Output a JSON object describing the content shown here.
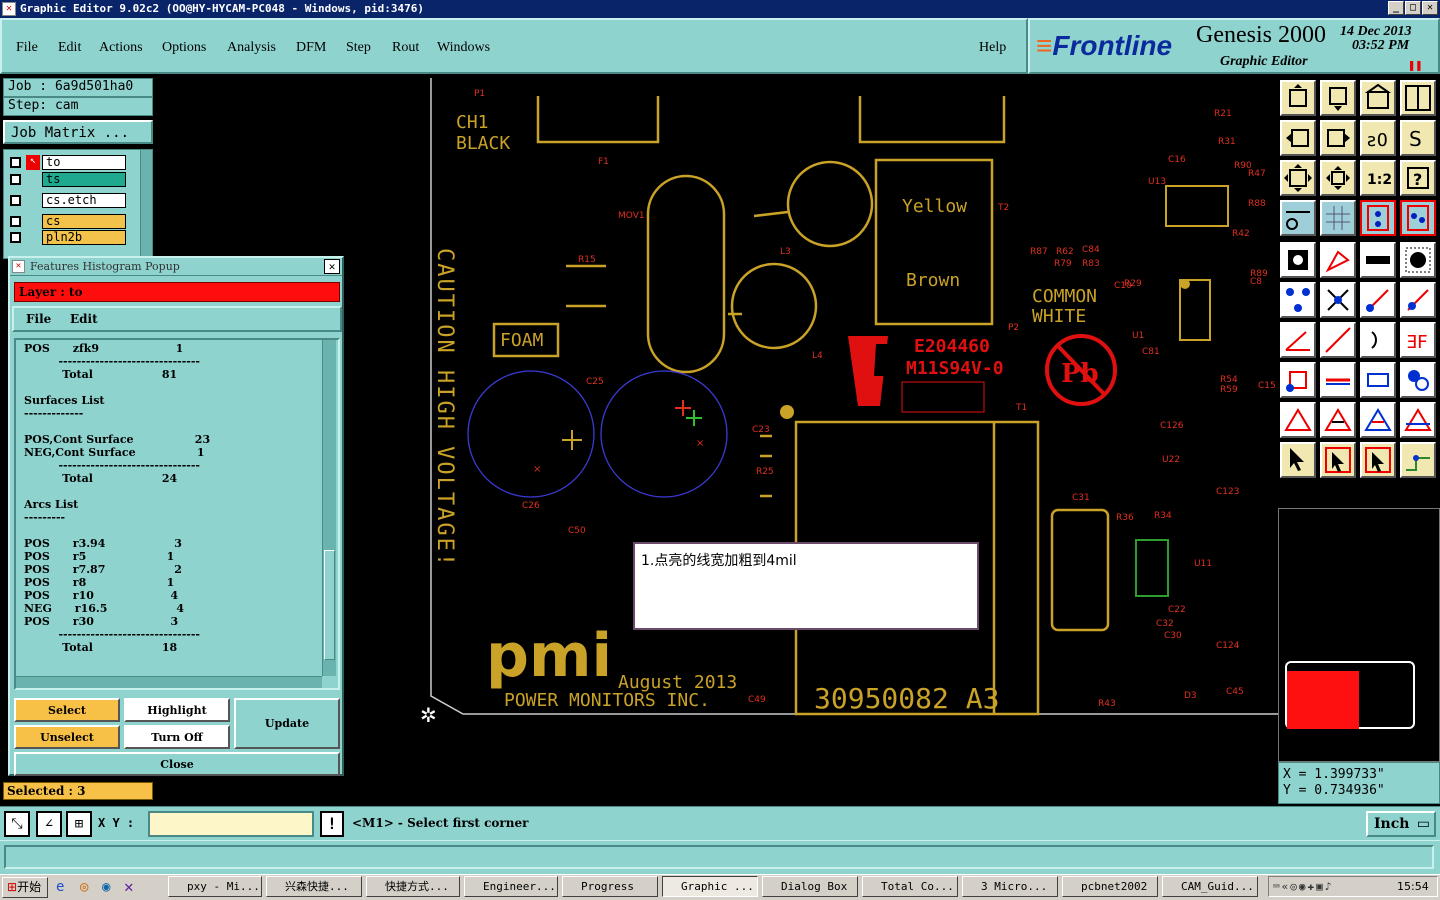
{
  "window": {
    "title": "Graphic Editor 9.02c2 (OO@HY-HYCAM-PC048 - Windows, pid:3476)"
  },
  "menu": [
    "File",
    "Edit",
    "Actions",
    "Options",
    "Analysis",
    "DFM",
    "Step",
    "Rout",
    "Windows"
  ],
  "help_label": "Help",
  "brand": {
    "logo": "Frontline",
    "product": "Genesis 2000",
    "subtitle": "Graphic Editor",
    "date": "14 Dec 2013",
    "time": "03:52 PM"
  },
  "job": {
    "job_label": "Job : 6a9d501ha0",
    "step_label": "Step: cam",
    "matrix_button": "Job Matrix ..."
  },
  "layers": [
    {
      "name": "to",
      "color": "#ffffff"
    },
    {
      "name": "ts",
      "color": "#1faa8f"
    },
    {
      "name": "cs.etch",
      "color": "#ffffff"
    },
    {
      "name": "cs",
      "color": "#f2c24a"
    },
    {
      "name": "pln2b",
      "color": "#f2c24a"
    }
  ],
  "popup": {
    "title": "Features Histogram Popup",
    "layer_label": "Layer :  to",
    "menu": [
      "File",
      "Edit"
    ],
    "lines": [
      "POS      zfk9                    1",
      "         -------------------------------",
      "          Total                  81",
      "",
      "Surfaces List",
      "-------------",
      "",
      "POS,Cont Surface                23",
      "NEG,Cont Surface                1",
      "         -------------------------------",
      "          Total                  24",
      "",
      "Arcs List",
      "---------",
      "",
      "POS      r3.94                  3",
      "POS      r5                     1",
      "POS      r7.87                  2",
      "POS      r8                     1",
      "POS      r10                    4",
      "NEG      r16.5                  4",
      "POS      r30                    3",
      "         -------------------------------",
      "          Total                  18"
    ],
    "buttons": {
      "select": "Select",
      "highlight": "Highlight",
      "update": "Update",
      "unselect": "Unselect",
      "turn_off": "Turn Off",
      "close": "Close"
    }
  },
  "selected_label": "Selected : 3",
  "coords": {
    "x": "X = 1.399733\"",
    "y": "Y = 0.734936\""
  },
  "bottom": {
    "xy_label": "X Y :",
    "xy_value": "",
    "prompt": "<M1> - Select first corner",
    "units": "Inch"
  },
  "note": "1.点亮的线宽加粗到4mil",
  "pcb": {
    "ch1": "CH1",
    "black": "BLACK",
    "caution": "CAUTION HIGH VOLTAGE!",
    "foam": "FOAM",
    "yellow": "Yellow",
    "brown": "Brown",
    "common": "COMMON",
    "white": "WHITE",
    "e_num": "E204460",
    "m_num": "M11S94V-0",
    "pmi": "pmi",
    "company": "POWER MONITORS INC.",
    "date": "August 2013",
    "part": "30950082  A3",
    "refs": [
      "P1",
      "F1",
      "MOV1",
      "R15",
      "L3",
      "T2",
      "L4",
      "C25",
      "C26",
      "C50",
      "C23",
      "R25",
      "P2",
      "T1",
      "R21",
      "R31",
      "C16",
      "U13",
      "R90",
      "R47",
      "R88",
      "R42",
      "R87",
      "R62",
      "C84",
      "R79",
      "R83",
      "R29",
      "C10",
      "U1",
      "C81",
      "R89",
      "C8",
      "R54",
      "R59",
      "C15",
      "C126",
      "U22",
      "C123",
      "C31",
      "R36",
      "R34",
      "U11",
      "C22",
      "C32",
      "C30",
      "C124",
      "C45",
      "R43",
      "D3",
      "C49"
    ]
  },
  "taskbar": {
    "start": "开始",
    "items": [
      "pxy - Mi...",
      "兴森快捷...",
      "快捷方式...",
      "Engineer...",
      "Progress",
      "Graphic ...",
      "Dialog Box",
      "Total Co...",
      "3 Micro...",
      "pcbnet2002",
      "CAM_Guid..."
    ],
    "clock": "15:54"
  }
}
